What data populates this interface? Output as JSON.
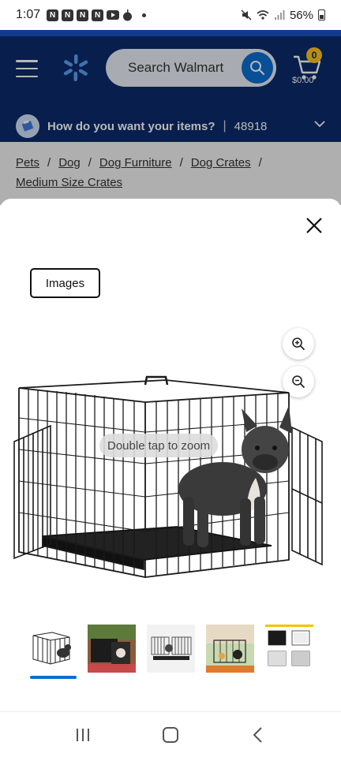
{
  "status": {
    "time": "1:07",
    "battery": "56%",
    "notif_letters": [
      "N",
      "N",
      "N",
      "N"
    ]
  },
  "header": {
    "search_placeholder": "Search Walmart",
    "cart_count": "0",
    "cart_total": "$0.00",
    "delivery_prompt": "How do you want your items?",
    "delivery_sep": "|",
    "zip": "48918"
  },
  "breadcrumb": {
    "items": [
      "Pets",
      "Dog",
      "Dog Furniture",
      "Dog Crates",
      "Medium Size Crates"
    ],
    "separator": "/"
  },
  "modal": {
    "images_tab": "Images",
    "zoom_hint": "Double tap to zoom",
    "thumbnail_count": 5,
    "selected_thumbnail": 1
  },
  "colors": {
    "header_bg": "#0c2a6b",
    "accent_blue": "#0a6ed1",
    "cart_badge": "#ffc220",
    "spark": "#5b9ff0"
  }
}
